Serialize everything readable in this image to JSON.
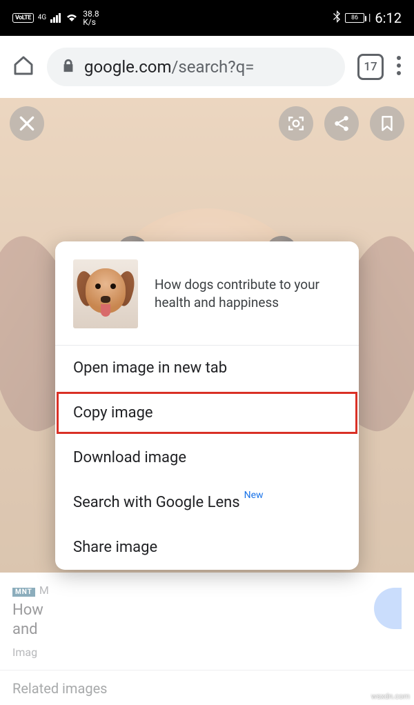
{
  "status": {
    "volte": "VoLTE",
    "net_gen": "4G",
    "speed_val": "38.8",
    "speed_unit": "K/s",
    "battery": "86",
    "time": "6:12"
  },
  "browser": {
    "url_host": "google.com",
    "url_path": "/search?q=",
    "tab_count": "17"
  },
  "page": {
    "source_badge": "MNT",
    "source_initial": "M",
    "title_line1": "How",
    "title_line2": "and",
    "subtitle": "Imag",
    "related": "Related images"
  },
  "context_menu": {
    "title": "How dogs contribute to your health and happiness",
    "items": [
      "Open image in new tab",
      "Copy image",
      "Download image",
      "Search with Google Lens",
      "Share image"
    ],
    "new_badge": "New"
  },
  "watermark": "wsxdn.com"
}
